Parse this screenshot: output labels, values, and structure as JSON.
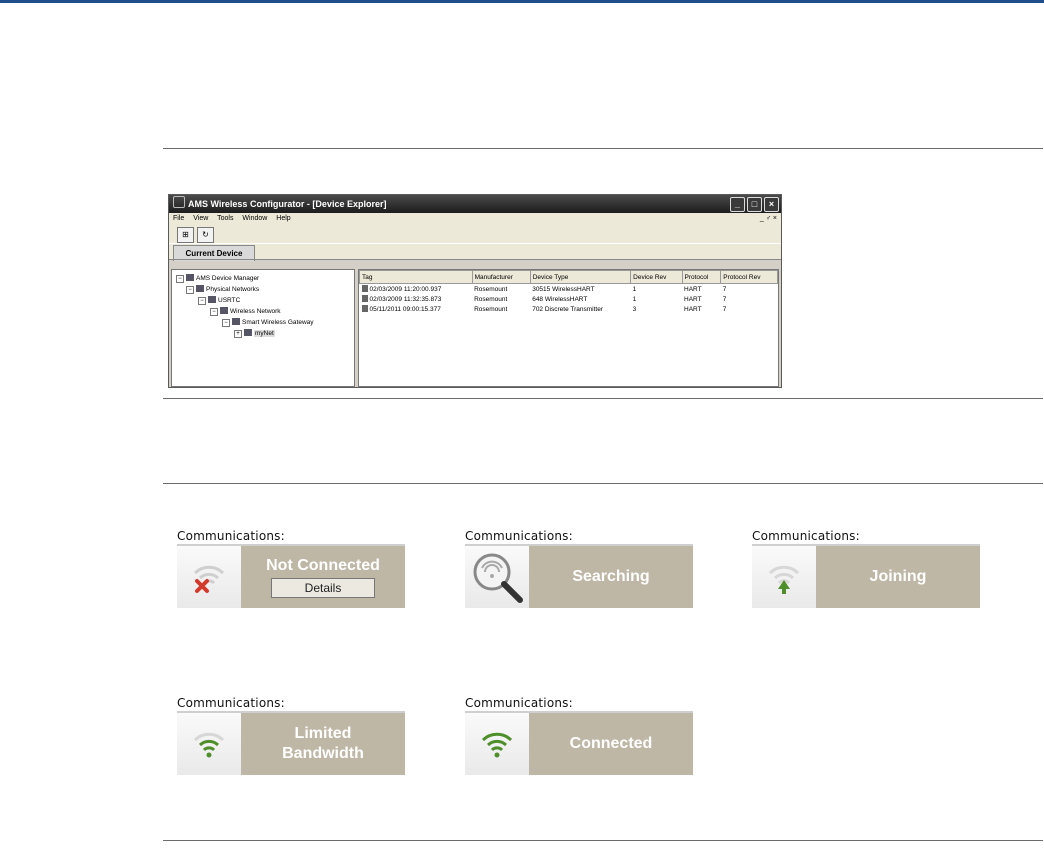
{
  "window": {
    "title": "AMS Wireless Configurator - [Device Explorer]",
    "menu": [
      "File",
      "View",
      "Tools",
      "Window",
      "Help"
    ],
    "mdi_controls": "_ ♂ ×",
    "tab": "Current Device",
    "tree": [
      {
        "label": "AMS Device Manager",
        "toggle": "−",
        "indent": 0
      },
      {
        "label": "Physical Networks",
        "toggle": "−",
        "indent": 1
      },
      {
        "label": "USRTC",
        "toggle": "−",
        "indent": 2
      },
      {
        "label": "Wireless Network",
        "toggle": "−",
        "indent": 3
      },
      {
        "label": "Smart Wireless Gateway",
        "toggle": "−",
        "indent": 4
      },
      {
        "label": "myNet",
        "toggle": "+",
        "indent": 5
      }
    ],
    "columns": [
      "Tag",
      "Manufacturer",
      "Device Type",
      "Device Rev",
      "Protocol",
      "Protocol Rev"
    ],
    "rows": [
      [
        "02/03/2009 11:20:00.937",
        "Rosemount",
        "30515 WirelessHART",
        "1",
        "HART",
        "7"
      ],
      [
        "02/03/2009 11:32:35.873",
        "Rosemount",
        "648 WirelessHART",
        "1",
        "HART",
        "7"
      ],
      [
        "05/11/2011 09:00:15.377",
        "Rosemount",
        "702 Discrete Transmitter",
        "3",
        "HART",
        "7"
      ]
    ]
  },
  "panels": [
    {
      "label": "Communications:",
      "status": "Not Connected",
      "button": "Details",
      "icon": "wifi-error-icon"
    },
    {
      "label": "Communications:",
      "status": "Searching",
      "icon": "magnifier-icon"
    },
    {
      "label": "Communications:",
      "status": "Joining",
      "icon": "wifi-joining-icon"
    },
    {
      "label": "Communications:",
      "status_lines": [
        "Limited",
        "Bandwidth"
      ],
      "icon": "wifi-limited-icon"
    },
    {
      "label": "Communications:",
      "status": "Connected",
      "icon": "wifi-connected-icon"
    }
  ],
  "colors": {
    "accent": "#1f4e8c",
    "status_bg": "#bfb7a6",
    "signal_green": "#4f8f2b",
    "error_red": "#d33a2c"
  }
}
